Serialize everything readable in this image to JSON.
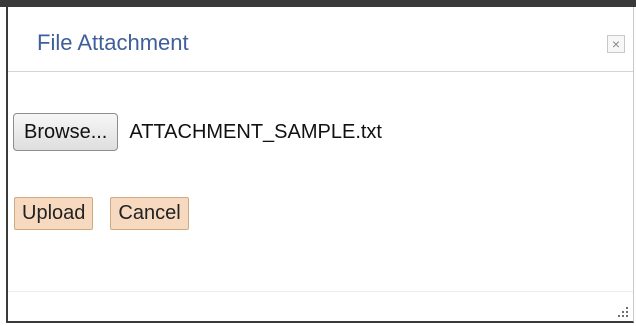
{
  "dialog": {
    "title": "File Attachment",
    "close_symbol": "×"
  },
  "file_picker": {
    "browse_label": "Browse...",
    "selected_file": "ATTACHMENT_SAMPLE.txt"
  },
  "actions": {
    "upload_label": "Upload",
    "cancel_label": "Cancel"
  },
  "icons": {
    "close": "close-icon",
    "resize": "resize-grip-icon"
  },
  "colors": {
    "title": "#3f5f9a",
    "action_button_bg": "#f7d9bf",
    "action_button_border": "#d0a983"
  }
}
